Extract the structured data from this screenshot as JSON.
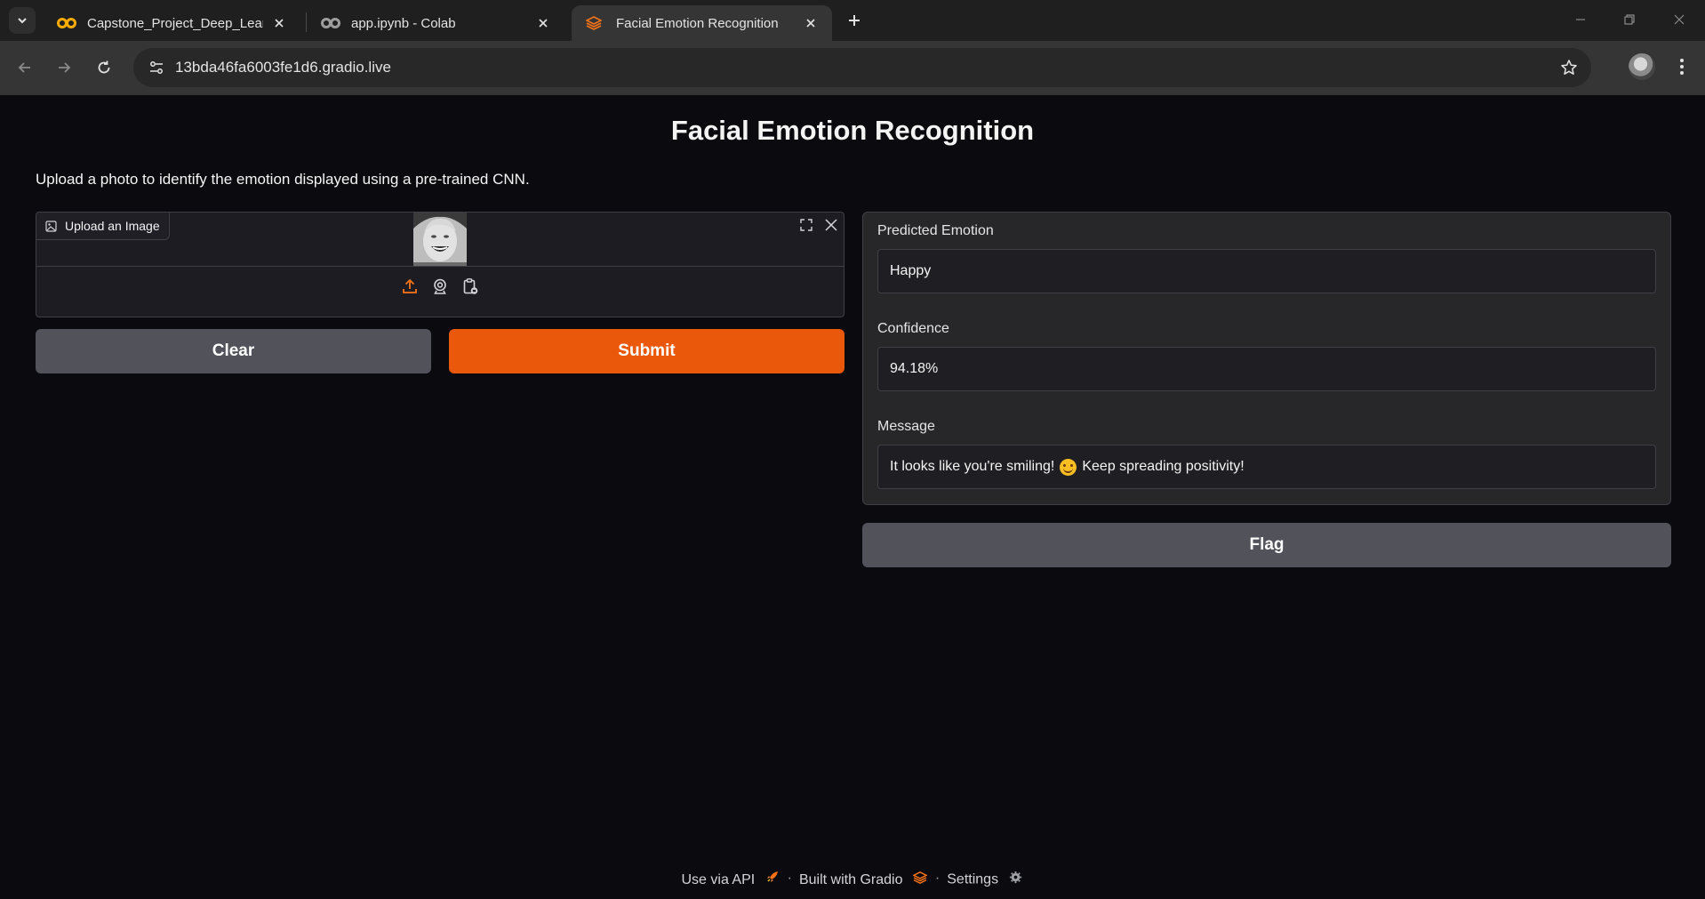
{
  "browser": {
    "tabs": [
      {
        "title": "Capstone_Project_Deep_Learnin",
        "active": false
      },
      {
        "title": "app.ipynb - Colab",
        "active": false
      },
      {
        "title": "Facial Emotion Recognition",
        "active": true
      }
    ],
    "url": "13bda46fa6003fe1d6.gradio.live"
  },
  "app": {
    "title": "Facial Emotion Recognition",
    "description": "Upload a photo to identify the emotion displayed using a pre-trained CNN.",
    "image_input": {
      "label": "Upload an Image"
    },
    "buttons": {
      "clear": "Clear",
      "submit": "Submit",
      "flag": "Flag"
    },
    "outputs": {
      "emotion": {
        "label": "Predicted Emotion",
        "value": "Happy"
      },
      "confidence": {
        "label": "Confidence",
        "value": "94.18%"
      },
      "message": {
        "label": "Message",
        "value_before": "It looks like you're smiling!",
        "value_after": "Keep spreading positivity!"
      }
    },
    "footer": {
      "api": "Use via API",
      "built": "Built with Gradio",
      "settings": "Settings",
      "separator": "·"
    }
  },
  "colors": {
    "primary": "#ea580c",
    "secondary": "#52525b",
    "background": "#0b0b0f",
    "panel": "#27272a"
  }
}
